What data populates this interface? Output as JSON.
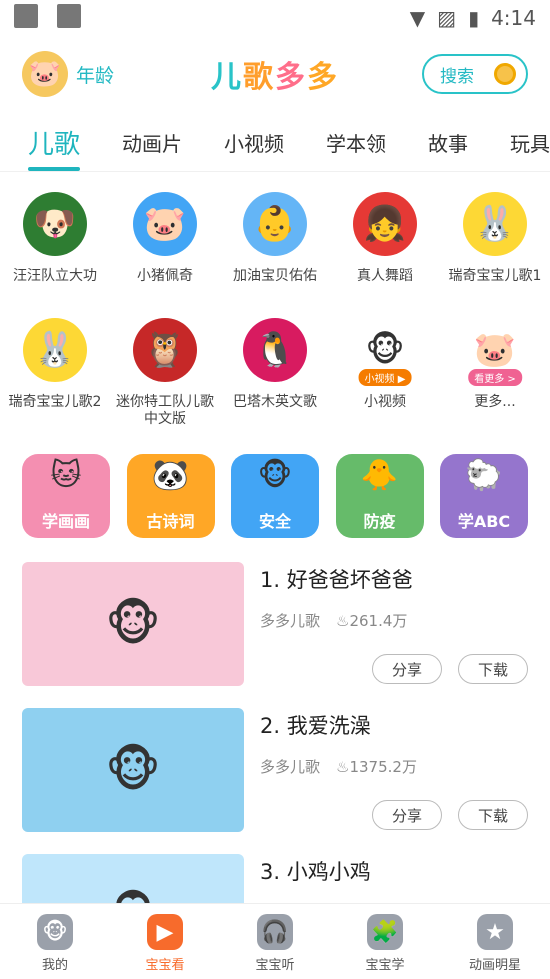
{
  "status_bar": {
    "time": "4:14"
  },
  "header": {
    "age_label": "年龄",
    "logo": [
      "儿",
      "歌",
      "多",
      "多"
    ],
    "search_label": "搜索"
  },
  "tabs": [
    {
      "label": "儿歌",
      "active": true
    },
    {
      "label": "动画片"
    },
    {
      "label": "小视频"
    },
    {
      "label": "学本领"
    },
    {
      "label": "故事"
    },
    {
      "label": "玩具"
    }
  ],
  "characters": [
    {
      "label": "汪汪队立大功",
      "icon": "dog-icon",
      "color": "#2e7d32"
    },
    {
      "label": "小猪佩奇",
      "icon": "pig-icon",
      "color": "#42a5f5"
    },
    {
      "label": "加油宝贝佑佑",
      "icon": "baby-icon",
      "color": "#64b5f6"
    },
    {
      "label": "真人舞蹈",
      "icon": "girl-icon",
      "color": "#e53935"
    },
    {
      "label": "瑞奇宝宝儿歌1",
      "icon": "rabbit-icon",
      "color": "#fdd835"
    },
    {
      "label": "瑞奇宝宝儿歌2",
      "icon": "rabbit-pink-icon",
      "color": "#fdd835"
    },
    {
      "label": "迷你特工队儿歌 中文版",
      "icon": "bird-icon",
      "color": "#c62828"
    },
    {
      "label": "巴塔木英文歌",
      "icon": "penguin-icon",
      "color": "#d81b60"
    },
    {
      "label": "小视频",
      "icon": "monkey-icon",
      "color": "#ffffff",
      "badge": "小视频 ▶"
    },
    {
      "label": "更多...",
      "icon": "pig-more-icon",
      "color": "#ffffff",
      "badge": "看更多 >"
    }
  ],
  "categories": [
    {
      "label": "学画画",
      "icon": "cat-icon",
      "color": "#f48fb1"
    },
    {
      "label": "古诗词",
      "icon": "panda-icon",
      "color": "#ffa726"
    },
    {
      "label": "安全",
      "icon": "monkey-captain-icon",
      "color": "#42a5f5"
    },
    {
      "label": "防疫",
      "icon": "chick-mask-icon",
      "color": "#66bb6a"
    },
    {
      "label": "学ABC",
      "icon": "sheep-icon",
      "color": "#9575cd"
    }
  ],
  "songs": [
    {
      "title": "1. 好爸爸坏爸爸",
      "author": "多多儿歌",
      "plays": "261.4万",
      "bg": "#f8c8d8",
      "share": "分享",
      "download": "下载"
    },
    {
      "title": "2. 我爱洗澡",
      "author": "多多儿歌",
      "plays": "1375.2万",
      "bg": "#8fd0f0",
      "share": "分享",
      "download": "下载"
    },
    {
      "title": "3. 小鸡小鸡",
      "author": "",
      "plays": "",
      "bg": "#bfe6fb",
      "share": "",
      "download": ""
    }
  ],
  "bottom_nav": [
    {
      "label": "我的",
      "icon": "monkey-face-icon"
    },
    {
      "label": "宝宝看",
      "icon": "tv-play-icon",
      "active": true
    },
    {
      "label": "宝宝听",
      "icon": "headphones-icon"
    },
    {
      "label": "宝宝学",
      "icon": "puzzle-icon"
    },
    {
      "label": "动画明星",
      "icon": "bear-star-icon"
    }
  ],
  "colors": {
    "accent": "#1fb5be",
    "nav_active": "#f76b2c"
  }
}
